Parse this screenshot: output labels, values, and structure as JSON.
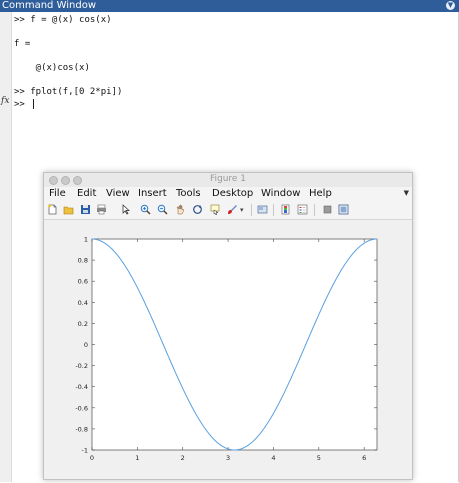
{
  "command_window": {
    "title": "Command Window",
    "menu_icon": "chevron-down-icon",
    "lines": [
      ">> f = @(x) cos(x)",
      "f =",
      "    @(x)cos(x)",
      ">> fplot(f,[0 2*pi])",
      ">> "
    ],
    "fx_label": "fx"
  },
  "figure": {
    "title": "Figure 1",
    "menu": [
      "File",
      "Edit",
      "View",
      "Insert",
      "Tools",
      "Desktop",
      "Window",
      "Help"
    ],
    "toolbar_icons": [
      "new-file-icon",
      "open-folder-icon",
      "save-icon",
      "print-icon",
      "pointer-icon",
      "zoom-in-icon",
      "zoom-out-icon",
      "pan-icon",
      "rotate-icon",
      "data-cursor-icon",
      "brush-icon",
      "link-icon",
      "colorbar-icon",
      "legend-icon",
      "hide-tools-icon",
      "dock-icon"
    ]
  },
  "chart_data": {
    "type": "line",
    "function": "cos(x)",
    "xlim": [
      0,
      6.283
    ],
    "ylim": [
      -1,
      1
    ],
    "x_ticks": [
      0,
      1,
      2,
      3,
      4,
      5,
      6
    ],
    "y_ticks": [
      -1,
      -0.8,
      -0.6,
      -0.4,
      -0.2,
      0,
      0.2,
      0.4,
      0.6,
      0.8,
      1
    ],
    "y_tick_labels": [
      "-1",
      "-0.8",
      "-0.6",
      "-0.4",
      "-0.2",
      "0",
      "0.2",
      "0.4",
      "0.6",
      "0.8",
      "1"
    ],
    "x_tick_labels": [
      "0",
      "1",
      "2",
      "3",
      "4",
      "5",
      "6"
    ],
    "series": [
      {
        "color": "#5aa0e0",
        "x": [
          0,
          0.314,
          0.628,
          0.942,
          1.257,
          1.571,
          1.885,
          2.199,
          2.513,
          2.827,
          3.142,
          3.456,
          3.77,
          4.084,
          4.398,
          4.712,
          5.027,
          5.341,
          5.655,
          5.969,
          6.283
        ],
        "y": [
          1,
          0.951,
          0.809,
          0.588,
          0.309,
          0,
          -0.309,
          -0.588,
          -0.809,
          -0.951,
          -1,
          -0.951,
          -0.809,
          -0.588,
          -0.309,
          0,
          0.309,
          0.588,
          0.809,
          0.951,
          1
        ]
      }
    ],
    "grid": false
  }
}
